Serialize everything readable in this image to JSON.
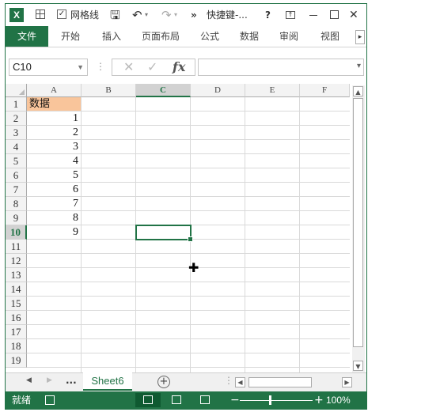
{
  "titlebar": {
    "app_icon": "X",
    "gridlines_label": "网格线",
    "more": "»",
    "title": "快捷键-...",
    "help": "?"
  },
  "ribbon": {
    "tabs": [
      "文件",
      "开始",
      "插入",
      "页面布局",
      "公式",
      "数据",
      "审阅",
      "视图"
    ]
  },
  "formula_bar": {
    "name_box": "C10",
    "fx_label": "fx",
    "value": ""
  },
  "sheet": {
    "columns": [
      "A",
      "B",
      "C",
      "D",
      "E",
      "F"
    ],
    "active_column": "C",
    "rows": [
      "1",
      "2",
      "3",
      "4",
      "5",
      "6",
      "7",
      "8",
      "9",
      "10",
      "11",
      "12",
      "13",
      "14",
      "15",
      "16",
      "17",
      "18",
      "19"
    ],
    "active_row": "10",
    "cells": {
      "A1": "数据",
      "A2": "1",
      "A3": "2",
      "A4": "3",
      "A5": "4",
      "A6": "5",
      "A7": "6",
      "A8": "7",
      "A9": "8",
      "A10": "9"
    },
    "selected_cell": "C10",
    "header_fill_color": "#f9c59b"
  },
  "sheet_tabs": {
    "ellipsis": "...",
    "active": "Sheet6",
    "add": "+"
  },
  "status_bar": {
    "ready": "就绪",
    "zoom": "100%",
    "accent": "#217346"
  }
}
